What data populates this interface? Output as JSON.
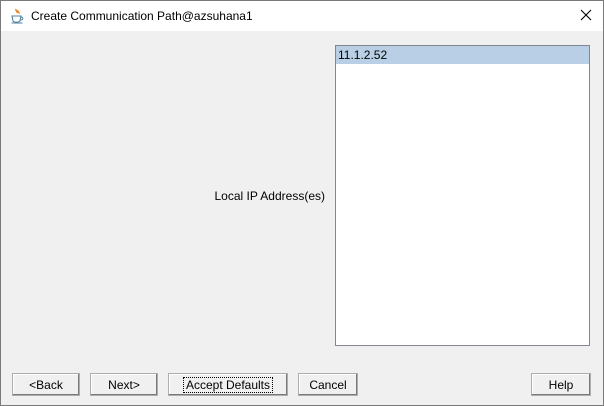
{
  "window": {
    "title": "Create Communication Path@azsuhana1"
  },
  "form": {
    "local_ip_label": "Local IP Address(es)",
    "ip_addresses": [
      "11.1.2.52"
    ],
    "selected_index": 0
  },
  "buttons": {
    "back": "<Back",
    "next": "Next>",
    "accept_defaults": "Accept Defaults",
    "cancel": "Cancel",
    "help": "Help"
  },
  "icons": {
    "app": "java-cup-icon",
    "close": "close-icon"
  }
}
